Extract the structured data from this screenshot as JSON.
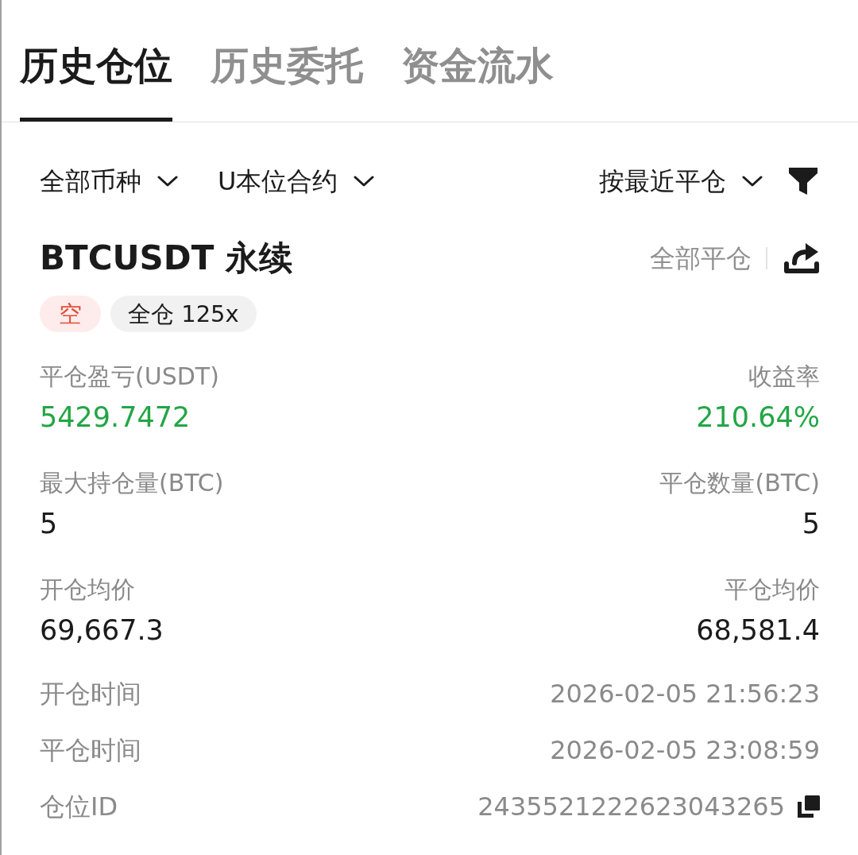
{
  "tabs": [
    {
      "label": "历史仓位",
      "selected": true
    },
    {
      "label": "历史委托",
      "selected": false
    },
    {
      "label": "资金流水",
      "selected": false
    }
  ],
  "filters": [
    {
      "label": "全部币种"
    },
    {
      "label": "U本位合约"
    }
  ],
  "sort": {
    "label": "按最近平仓"
  },
  "position": {
    "symbol": "BTCUSDT 永续",
    "close_all": "全部平仓",
    "tags": [
      {
        "label": "空",
        "kind": "side"
      },
      {
        "label": "全仓 125x",
        "kind": "margin"
      }
    ],
    "stats": [
      {
        "label": "平仓盈亏(USDT)",
        "value": "5429.7472",
        "kind": "gain"
      },
      {
        "label": "收益率",
        "value": "210.64%",
        "kind": "gain"
      },
      {
        "label": "最大持仓量(BTC)",
        "value": "5",
        "kind": "plain"
      },
      {
        "label": "平仓数量(BTC)",
        "value": "5",
        "kind": "plain"
      },
      {
        "label": "开仓均价",
        "value": "69,667.3",
        "kind": "plain"
      },
      {
        "label": "平仓均价",
        "value": "68,581.4",
        "kind": "plain"
      }
    ],
    "details": [
      {
        "label": "开仓时间",
        "value": "2026-02-05 21:56:23",
        "copyable": false
      },
      {
        "label": "平仓时间",
        "value": "2026-02-05 23:08:59",
        "copyable": false
      },
      {
        "label": "仓位ID",
        "value": "2435521222623043265",
        "copyable": true
      }
    ]
  }
}
